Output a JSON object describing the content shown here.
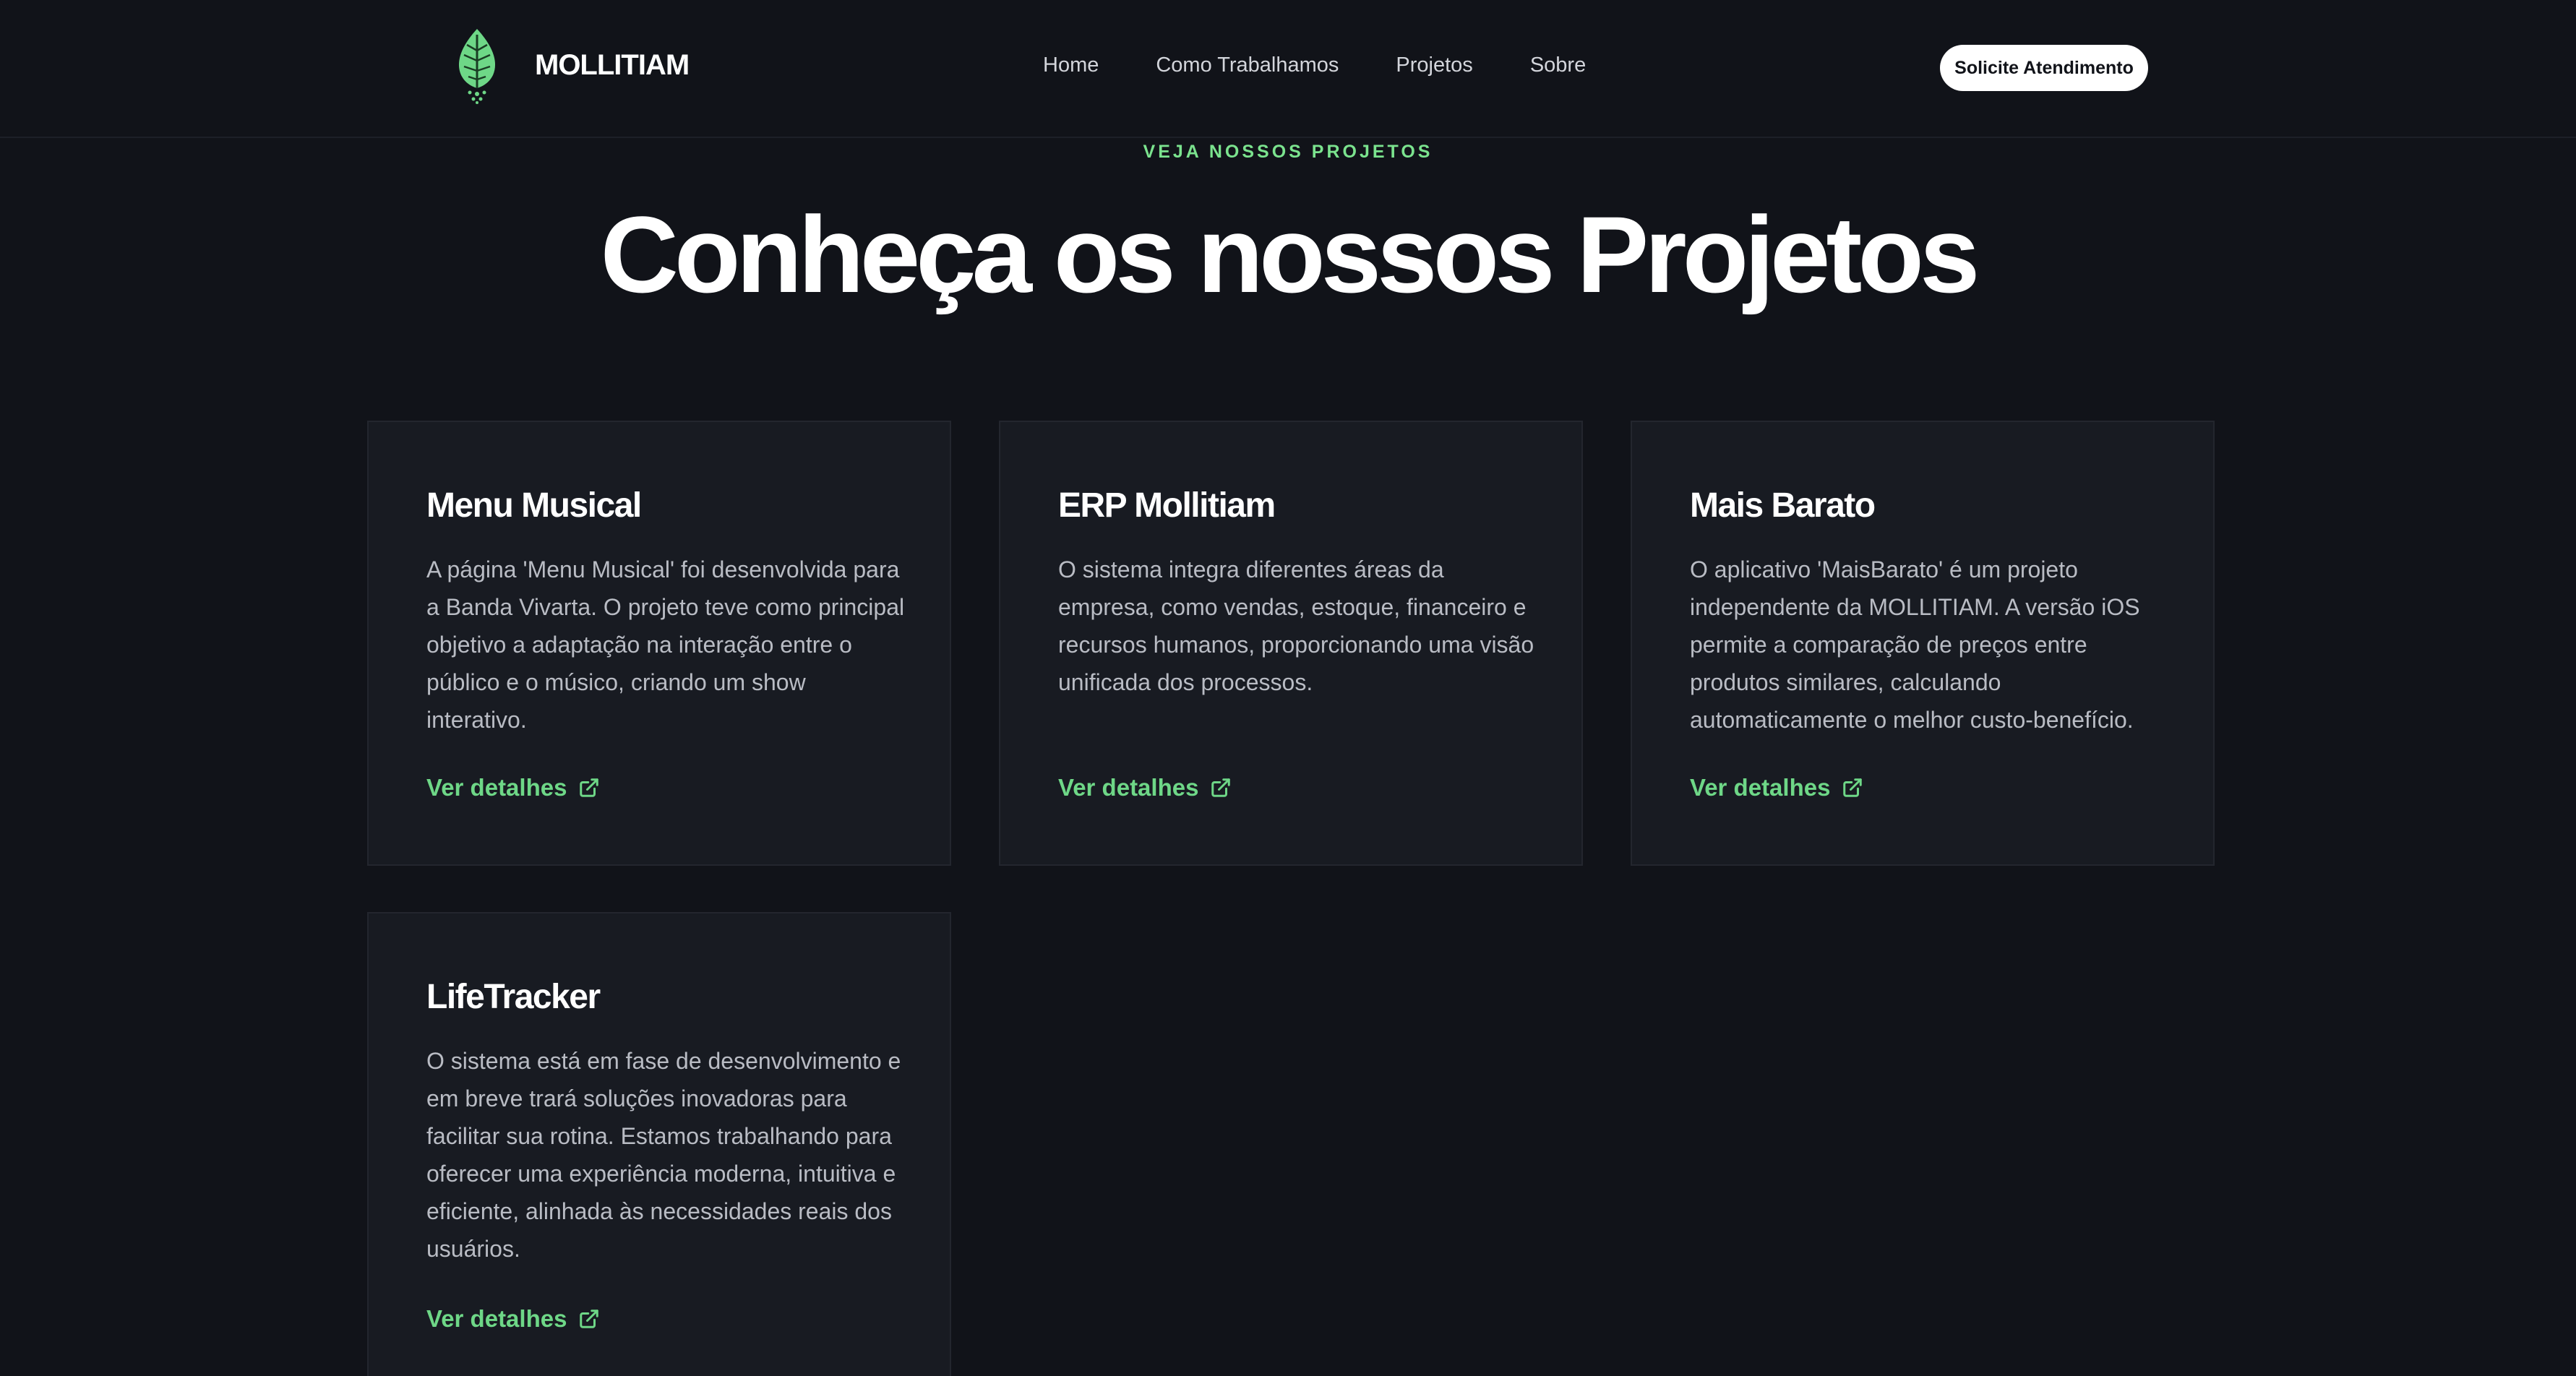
{
  "header": {
    "brand": "MOLLITIAM",
    "nav": [
      "Home",
      "Como Trabalhamos",
      "Projetos",
      "Sobre"
    ],
    "cta_label": "Solicite Atendimento"
  },
  "hero": {
    "eyebrow": "VEJA NOSSOS PROJETOS",
    "title": "Conheça os nossos Projetos"
  },
  "projects": [
    {
      "title": "Menu Musical",
      "description": "A página 'Menu Musical' foi desenvolvida para a Banda Vivarta. O projeto teve como principal objetivo a adaptação na interação entre o público e o músico, criando um show interativo.",
      "link_label": "Ver detalhes"
    },
    {
      "title": "ERP Mollitiam",
      "description": "O sistema integra diferentes áreas da empresa, como vendas, estoque, financeiro e recursos humanos, proporcionando uma visão unificada dos processos.",
      "link_label": "Ver detalhes"
    },
    {
      "title": "Mais Barato",
      "description": "O aplicativo 'MaisBarato' é um projeto independente da MOLLITIAM. A versão iOS permite a comparação de preços entre produtos similares, calculando automaticamente o melhor custo-benefício.",
      "link_label": "Ver detalhes"
    },
    {
      "title": "LifeTracker",
      "description": "O sistema está em fase de desenvolvimento e em breve trará soluções inovadoras para facilitar sua rotina. Estamos trabalhando para oferecer uma experiência moderna, intuitiva e eficiente, alinhada às necessidades reais dos usuários.",
      "link_label": "Ver detalhes"
    }
  ],
  "colors": {
    "background": "#111319",
    "card": "#181b22",
    "accent": "#6ed787",
    "text": "#ffffff",
    "muted": "#b9bcc4"
  },
  "icons": {
    "logo": "leaf-logo-icon",
    "link": "external-link-icon"
  }
}
